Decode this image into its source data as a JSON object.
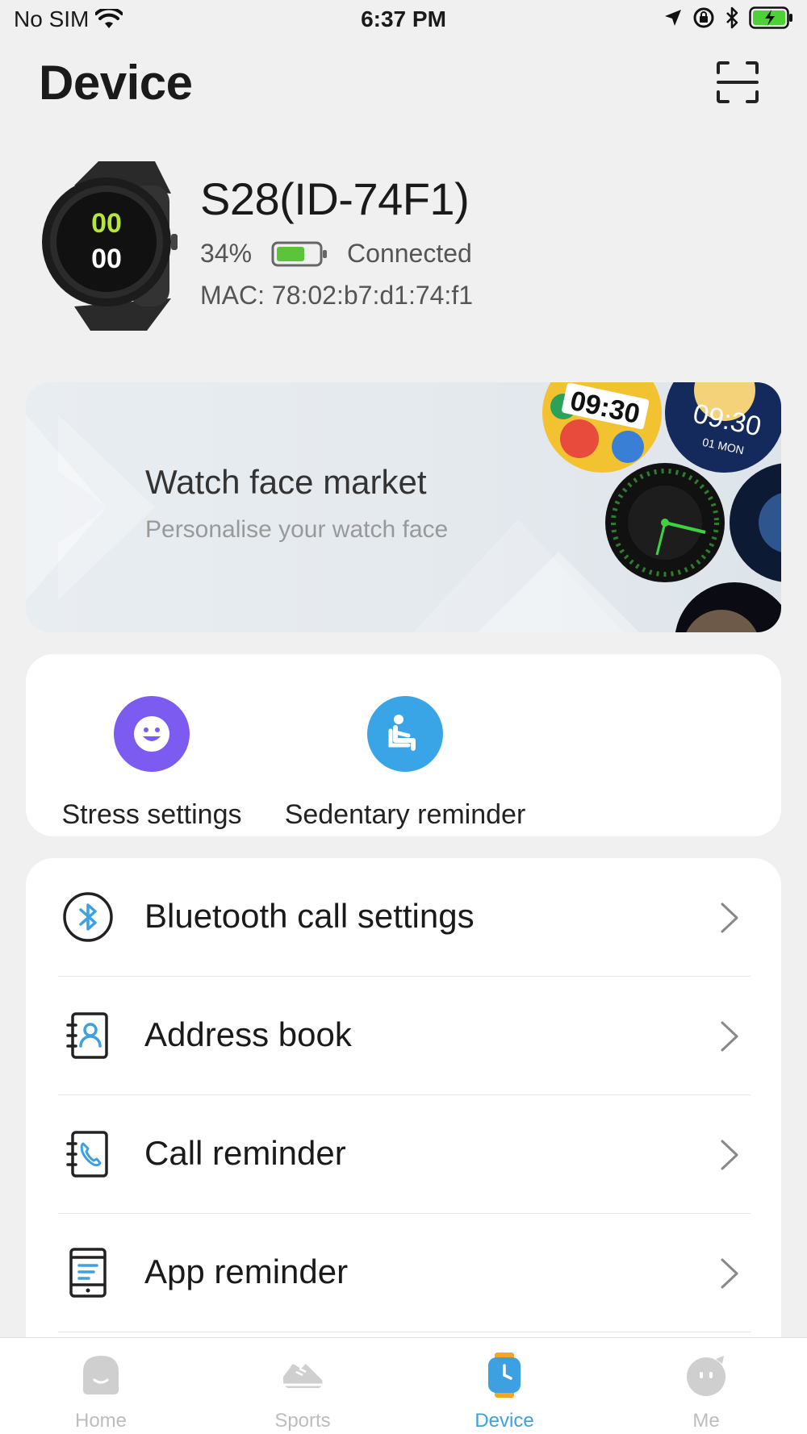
{
  "status_bar": {
    "carrier": "No SIM",
    "time": "6:37 PM"
  },
  "header": {
    "title": "Device"
  },
  "device": {
    "name": "S28(ID-74F1)",
    "battery_percent": "34%",
    "battery_level": 0.34,
    "connection_status": "Connected",
    "mac": "MAC: 78:02:b7:d1:74:f1",
    "watch_display": "00 00"
  },
  "market": {
    "title": "Watch face market",
    "subtitle": "Personalise your watch face",
    "face1_time": "09:30",
    "face2_time": "09:30",
    "face2_date": "01 MON"
  },
  "quick_actions": [
    {
      "label": "Stress settings",
      "icon": "smiley-icon",
      "color": "#7c5cf0"
    },
    {
      "label": "Sedentary reminder",
      "icon": "seated-person-icon",
      "color": "#3aa5e6"
    }
  ],
  "settings_list": [
    {
      "label": "Bluetooth call settings",
      "icon": "bluetooth-icon"
    },
    {
      "label": "Address book",
      "icon": "contacts-icon"
    },
    {
      "label": "Call reminder",
      "icon": "phone-icon"
    },
    {
      "label": "App reminder",
      "icon": "phone-notification-icon"
    }
  ],
  "tabs": [
    {
      "label": "Home",
      "icon": "home-icon",
      "active": false
    },
    {
      "label": "Sports",
      "icon": "sneaker-icon",
      "active": false
    },
    {
      "label": "Device",
      "icon": "watch-icon",
      "active": true
    },
    {
      "label": "Me",
      "icon": "face-icon",
      "active": false
    }
  ],
  "colors": {
    "accent": "#3da0e0",
    "battery_fill": "#5ac43a",
    "stress": "#7c5cf0",
    "sedentary": "#3aa5e6",
    "tab_inactive": "#bdbdbd"
  }
}
